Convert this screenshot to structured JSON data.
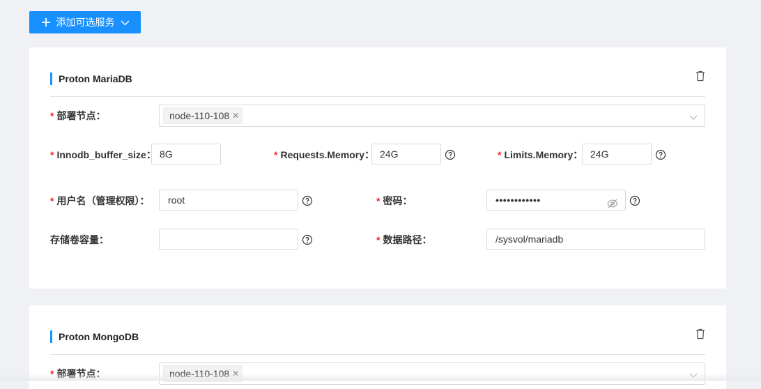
{
  "toolbar": {
    "add_label": "添加可选服务"
  },
  "mariadb": {
    "title": "Proton MariaDB",
    "deploy_label": "部署节点",
    "deploy_tag": "node-110-108",
    "innodb_label": "Innodb_buffer_size",
    "innodb_value": "8G",
    "req_mem_label": "Requests.Memory",
    "req_mem_value": "24G",
    "lim_mem_label": "Limits.Memory",
    "lim_mem_value": "24G",
    "user_label": "用户名（管理权限）",
    "user_value": "root",
    "pwd_label": "密码",
    "pwd_value": "••••••••••••",
    "storage_label": "存储卷容量",
    "storage_value": "",
    "path_label": "数据路径",
    "path_value": "/sysvol/mariadb"
  },
  "mongodb": {
    "title": "Proton MongoDB",
    "deploy_label": "部署节点",
    "deploy_tag": "node-110-108"
  },
  "colors": {
    "accent": "#1890ff",
    "required": "#f5222d",
    "background": "#f0f1f4"
  },
  "icons": [
    "plus-icon",
    "chevron-down-icon",
    "trash-icon",
    "close-icon",
    "help-circle-icon",
    "eye-off-icon"
  ]
}
